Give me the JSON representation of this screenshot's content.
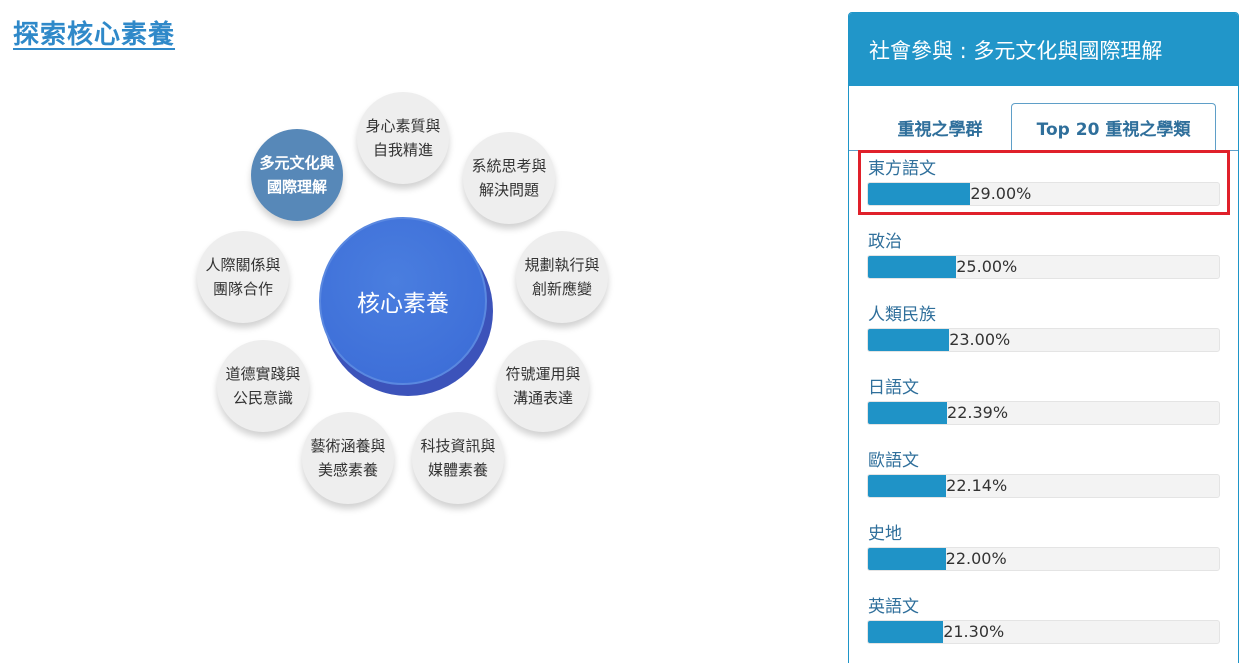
{
  "page": {
    "title": "探索核心素養"
  },
  "wheel": {
    "core": "核心素養",
    "bubbles": [
      {
        "line1": "身心素質與",
        "line2": "自我精進",
        "active": false
      },
      {
        "line1": "系統思考與",
        "line2": "解決問題",
        "active": false
      },
      {
        "line1": "規劃執行與",
        "line2": "創新應變",
        "active": false
      },
      {
        "line1": "符號運用與",
        "line2": "溝通表達",
        "active": false
      },
      {
        "line1": "科技資訊與",
        "line2": "媒體素養",
        "active": false
      },
      {
        "line1": "藝術涵養與",
        "line2": "美感素養",
        "active": false
      },
      {
        "line1": "道德實踐與",
        "line2": "公民意識",
        "active": false
      },
      {
        "line1": "人際關係與",
        "line2": "團隊合作",
        "active": false
      },
      {
        "line1": "多元文化與",
        "line2": "國際理解",
        "active": true
      }
    ]
  },
  "panel": {
    "header": "社會參與 : 多元文化與國際理解",
    "tabs": [
      {
        "label": "重視之學群",
        "active": false
      },
      {
        "label": "Top 20 重視之學類",
        "active": true
      }
    ],
    "items": [
      {
        "label": "東方語文",
        "value": "29.00%",
        "percent": 29.0
      },
      {
        "label": "政治",
        "value": "25.00%",
        "percent": 25.0
      },
      {
        "label": "人類民族",
        "value": "23.00%",
        "percent": 23.0
      },
      {
        "label": "日語文",
        "value": "22.39%",
        "percent": 22.39
      },
      {
        "label": "歐語文",
        "value": "22.14%",
        "percent": 22.14
      },
      {
        "label": "史地",
        "value": "22.00%",
        "percent": 22.0
      },
      {
        "label": "英語文",
        "value": "21.30%",
        "percent": 21.3
      }
    ]
  },
  "colors": {
    "accent": "#2196c9",
    "bar": "#1f93c7",
    "active_bubble": "#5788b8",
    "core": "#3a6ad6",
    "highlight": "#e0202a"
  }
}
